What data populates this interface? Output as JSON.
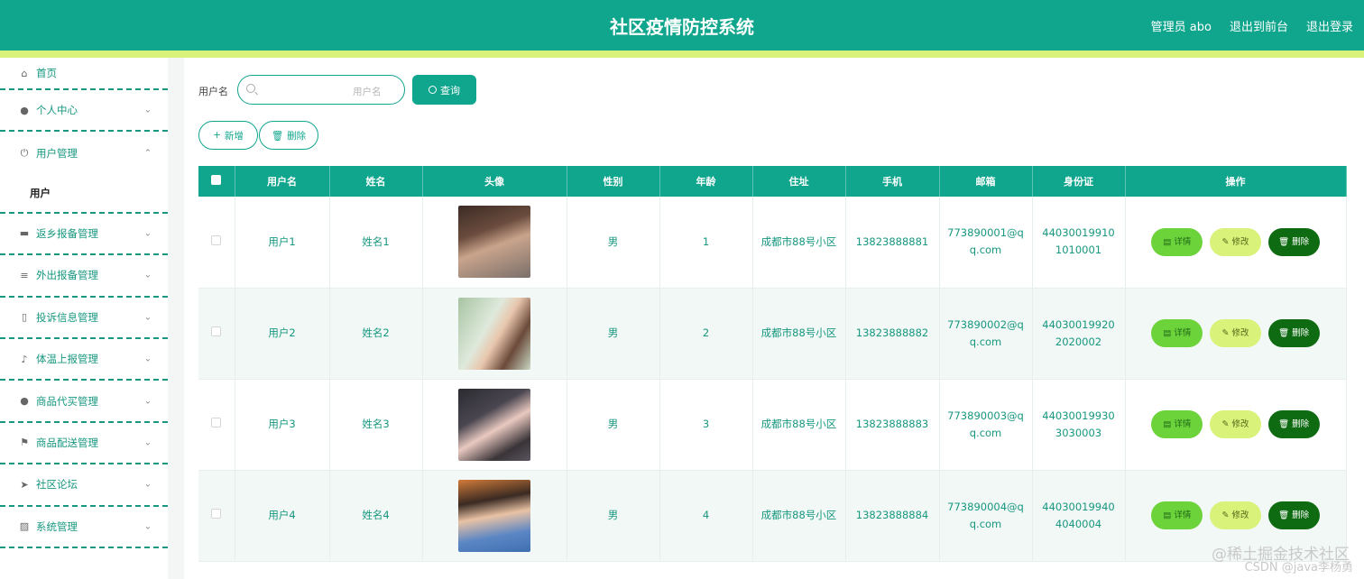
{
  "header": {
    "title": "社区疫情防控系统",
    "links": [
      "管理员 abo",
      "退出到前台",
      "退出登录"
    ]
  },
  "sidebar": {
    "items": [
      {
        "label": "首页",
        "icon": "home-icon",
        "chevron": false
      },
      {
        "label": "个人中心",
        "icon": "user-icon",
        "chevron": "down"
      },
      {
        "label": "用户管理",
        "icon": "power-icon",
        "chevron": "up"
      },
      {
        "label": "返乡报备管理",
        "icon": "chat-icon",
        "chevron": "down"
      },
      {
        "label": "外出报备管理",
        "icon": "menu-icon",
        "chevron": "down"
      },
      {
        "label": "投诉信息管理",
        "icon": "phone-icon",
        "chevron": "down"
      },
      {
        "label": "体温上报管理",
        "icon": "mic-icon",
        "chevron": "down"
      },
      {
        "label": "商品代买管理",
        "icon": "user-icon",
        "chevron": "down"
      },
      {
        "label": "商品配送管理",
        "icon": "flag-icon",
        "chevron": "down"
      },
      {
        "label": "社区论坛",
        "icon": "send-icon",
        "chevron": "down"
      },
      {
        "label": "系统管理",
        "icon": "chart-icon",
        "chevron": "down"
      }
    ],
    "subitem": "用户"
  },
  "search": {
    "label": "用户名",
    "placeholder": "用户名",
    "button": "查询"
  },
  "actions": {
    "add": "新增",
    "delete": "删除"
  },
  "table": {
    "columns": [
      "用户名",
      "姓名",
      "头像",
      "性别",
      "年龄",
      "住址",
      "手机",
      "邮箱",
      "身份证",
      "操作"
    ],
    "rows": [
      {
        "username": "用户1",
        "name": "姓名1",
        "gender": "男",
        "age": "1",
        "address": "成都市88号小区",
        "phone": "13823888881",
        "email": "773890001@qq.com",
        "id_card": "440300199101010001"
      },
      {
        "username": "用户2",
        "name": "姓名2",
        "gender": "男",
        "age": "2",
        "address": "成都市88号小区",
        "phone": "13823888882",
        "email": "773890002@qq.com",
        "id_card": "440300199202020002"
      },
      {
        "username": "用户3",
        "name": "姓名3",
        "gender": "男",
        "age": "3",
        "address": "成都市88号小区",
        "phone": "13823888883",
        "email": "773890003@qq.com",
        "id_card": "440300199303030003"
      },
      {
        "username": "用户4",
        "name": "姓名4",
        "gender": "男",
        "age": "4",
        "address": "成都市88号小区",
        "phone": "13823888884",
        "email": "773890004@qq.com",
        "id_card": "440300199404040004"
      }
    ],
    "ops": {
      "detail": "详情",
      "edit": "修改",
      "delete": "删除"
    }
  },
  "watermark": {
    "line1": "@稀土掘金技术社区",
    "line2": "CSDN @java李杨勇"
  },
  "colors": {
    "primary": "#10a58d",
    "accent": "#d8f27a",
    "detail": "#6cd33a",
    "danger": "#0f6b12"
  }
}
